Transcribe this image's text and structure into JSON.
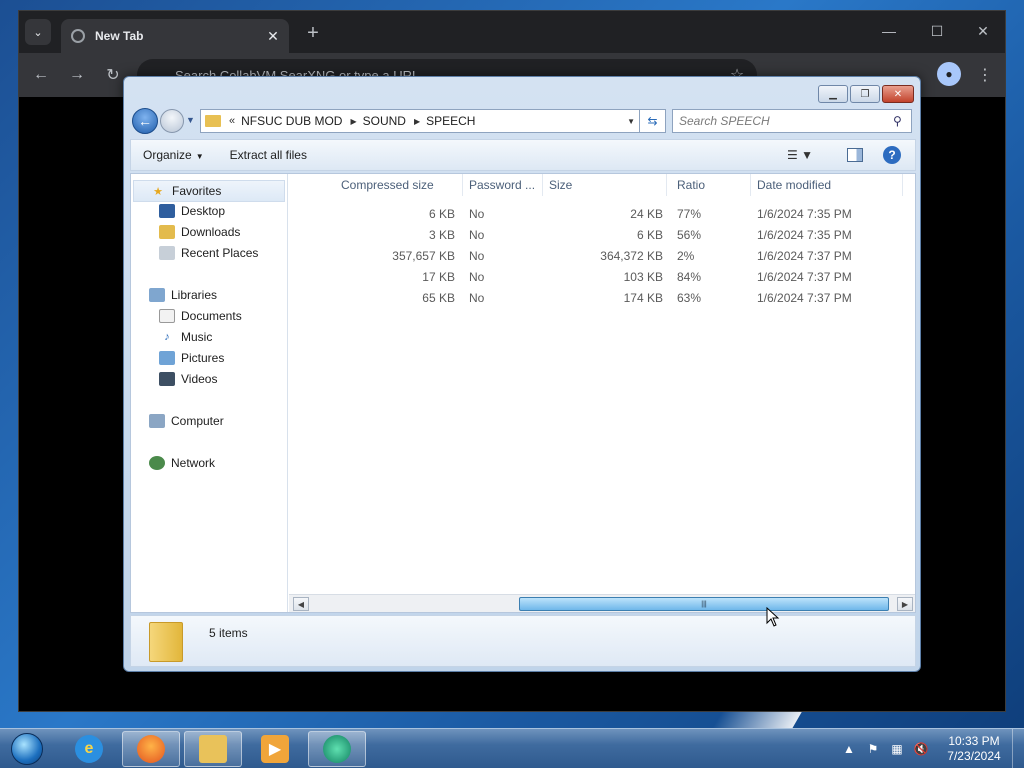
{
  "browser": {
    "tab_title": "New Tab",
    "omnibox_placeholder": "Search CollabVM SearXNG or type a URL",
    "icons": {
      "tab_search": "chevron-down-icon",
      "favicon": "globe-icon",
      "tab_close": "close-icon",
      "new_tab": "plus-icon",
      "back": "arrow-left-icon",
      "forward": "arrow-right-icon",
      "reload": "reload-icon",
      "star": "star-icon",
      "profile": "profile-icon",
      "menu": "more-vertical-icon"
    }
  },
  "explorer": {
    "address": {
      "overflow": "«",
      "crumbs": [
        "NFSUC DUB MOD",
        "SOUND",
        "SPEECH"
      ]
    },
    "search_placeholder": "Search SPEECH",
    "commands": {
      "organize": "Organize",
      "extract": "Extract all files"
    },
    "nav_pane": {
      "favorites": "Favorites",
      "desktop": "Desktop",
      "downloads": "Downloads",
      "recent": "Recent Places",
      "libraries": "Libraries",
      "documents": "Documents",
      "music": "Music",
      "pictures": "Pictures",
      "videos": "Videos",
      "computer": "Computer",
      "network": "Network"
    },
    "columns": {
      "compressed": "Compressed size",
      "password": "Password ...",
      "size": "Size",
      "ratio": "Ratio",
      "modified": "Date modified"
    },
    "rows": [
      {
        "compressed": "6 KB",
        "password": "No",
        "size": "24 KB",
        "ratio": "77%",
        "modified": "1/6/2024 7:35 PM"
      },
      {
        "compressed": "3 KB",
        "password": "No",
        "size": "6 KB",
        "ratio": "56%",
        "modified": "1/6/2024 7:35 PM"
      },
      {
        "compressed": "357,657 KB",
        "password": "No",
        "size": "364,372 KB",
        "ratio": "2%",
        "modified": "1/6/2024 7:37 PM"
      },
      {
        "compressed": "17 KB",
        "password": "No",
        "size": "103 KB",
        "ratio": "84%",
        "modified": "1/6/2024 7:37 PM"
      },
      {
        "compressed": "65 KB",
        "password": "No",
        "size": "174 KB",
        "ratio": "63%",
        "modified": "1/6/2024 7:37 PM"
      }
    ],
    "status": "5 items"
  },
  "taskbar": {
    "time": "10:33 PM",
    "date": "7/23/2024",
    "apps": [
      "internet-explorer-icon",
      "firefox-icon",
      "file-explorer-icon",
      "media-player-icon",
      "app-icon"
    ]
  }
}
